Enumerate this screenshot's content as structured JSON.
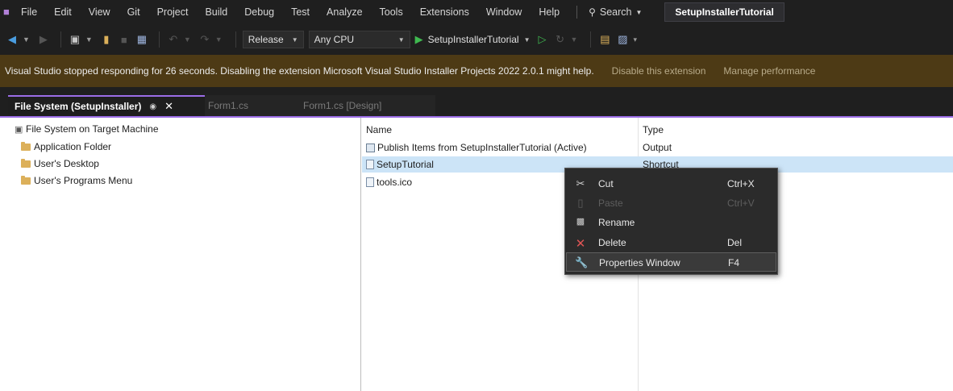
{
  "menubar": {
    "items": [
      "File",
      "Edit",
      "View",
      "Git",
      "Project",
      "Build",
      "Debug",
      "Test",
      "Analyze",
      "Tools",
      "Extensions",
      "Window",
      "Help"
    ],
    "search_label": "Search",
    "solution_name": "SetupInstallerTutorial"
  },
  "toolbar": {
    "configuration": "Release",
    "platform": "Any CPU",
    "startup_project": "SetupInstallerTutorial"
  },
  "infobar": {
    "message": "Visual Studio stopped responding for 26 seconds. Disabling the extension Microsoft Visual Studio Installer Projects 2022 2.0.1 might help.",
    "link_disable": "Disable this extension",
    "link_manage": "Manage performance"
  },
  "tabs": [
    {
      "label": "File System (SetupInstaller)",
      "active": true
    },
    {
      "label": "Form1.cs",
      "active": false
    },
    {
      "label": "Form1.cs [Design]",
      "active": false
    }
  ],
  "tree": {
    "root": "File System on Target Machine",
    "children": [
      "Application Folder",
      "User's Desktop",
      "User's Programs Menu"
    ]
  },
  "list": {
    "headers": {
      "name": "Name",
      "type": "Type"
    },
    "rows": [
      {
        "name": "Publish Items from SetupInstallerTutorial (Active)",
        "type": "Output"
      },
      {
        "name": "SetupTutorial",
        "type": "Shortcut",
        "selected": true
      },
      {
        "name": "tools.ico",
        "type": ""
      }
    ]
  },
  "context_menu": {
    "items": [
      {
        "label": "Cut",
        "shortcut": "Ctrl+X",
        "icon": "scissors-icon",
        "enabled": true
      },
      {
        "label": "Paste",
        "shortcut": "Ctrl+V",
        "icon": "paste-icon",
        "enabled": false
      },
      {
        "label": "Rename",
        "shortcut": "",
        "icon": "rename-icon",
        "enabled": true
      },
      {
        "label": "Delete",
        "shortcut": "Del",
        "icon": "delete-icon",
        "enabled": true
      },
      {
        "label": "Properties Window",
        "shortcut": "F4",
        "icon": "wrench-icon",
        "enabled": true,
        "hot": true
      }
    ]
  },
  "colors": {
    "accent": "#9b6de6",
    "infobar_bg": "#4d3a15",
    "selection": "#cce4f7",
    "run_green": "#3fb950",
    "delete_red": "#e05555"
  }
}
